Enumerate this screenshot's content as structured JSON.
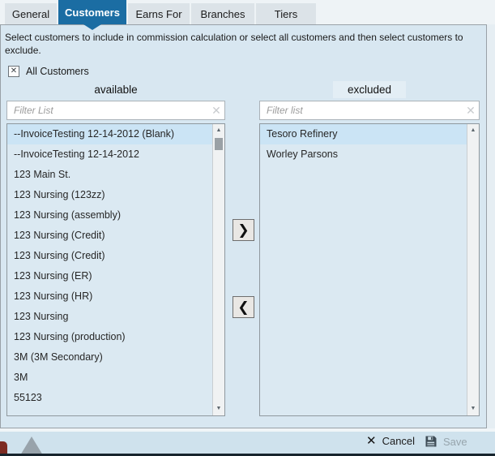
{
  "tabs": [
    {
      "label": "General",
      "active": false
    },
    {
      "label": "Customers",
      "active": true
    },
    {
      "label": "Earns For",
      "active": false
    },
    {
      "label": "Branches",
      "active": false
    },
    {
      "label": "Tiers",
      "active": false
    }
  ],
  "description": "Select customers to include in commission calculation or select all customers and then select customers to exclude.",
  "all_customers_checkbox": {
    "label": "All Customers",
    "checked": true,
    "check_glyph": "✕"
  },
  "available": {
    "header": "available",
    "filter": {
      "value": "",
      "placeholder": "Filter List"
    },
    "clear_icon": "✕",
    "items": [
      "--InvoiceTesting 12-14-2012 (Blank)",
      "--InvoiceTesting 12-14-2012",
      "123 Main St.",
      "123 Nursing (123zz)",
      "123 Nursing (assembly)",
      "123 Nursing (Credit)",
      "123 Nursing (Credit)",
      "123 Nursing (ER)",
      "123 Nursing (HR)",
      "123 Nursing",
      "123 Nursing (production)",
      "3M (3M Secondary)",
      "3M",
      "55123"
    ],
    "selected_index": 0
  },
  "excluded": {
    "header": "excluded",
    "filter": {
      "value": "",
      "placeholder": "Filter list"
    },
    "clear_icon": "✕",
    "items": [
      "Tesoro Refinery",
      "Worley Parsons"
    ],
    "selected_index": 0
  },
  "transfer_buttons": {
    "move_right_glyph": "❯",
    "move_left_glyph": "❮"
  },
  "scrollbar": {
    "up_glyph": "▲",
    "down_glyph": "▼"
  },
  "footer": {
    "cancel": {
      "label": "Cancel",
      "icon_glyph": "✕"
    },
    "save": {
      "label": "Save",
      "enabled": false
    }
  },
  "colors": {
    "active_tab": "#1b6da3",
    "panel_bg": "#d8e7f1",
    "list_bg": "#dbe9f2",
    "selected_item_bg": "#cbe4f5",
    "footer_bg": "#cfe2ed",
    "bottom_line": "#17242d"
  }
}
